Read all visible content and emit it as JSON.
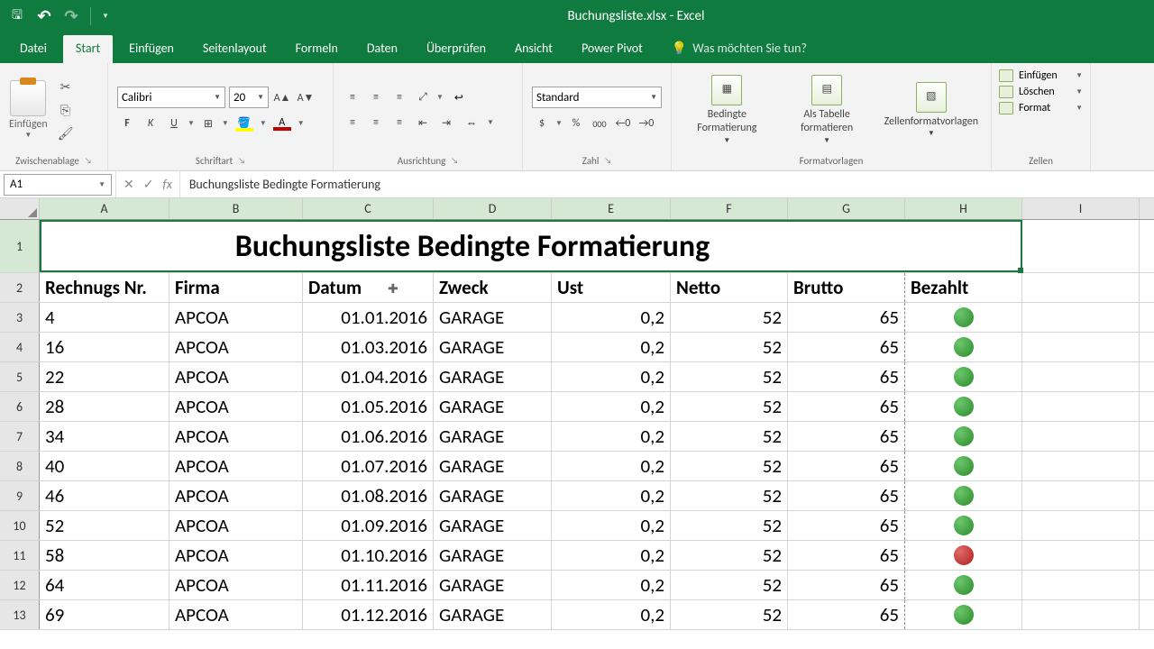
{
  "window": {
    "title": "Buchungsliste.xlsx - Excel"
  },
  "tabs": {
    "file": "Datei",
    "home": "Start",
    "insert": "Einfügen",
    "layout": "Seitenlayout",
    "formulas": "Formeln",
    "data": "Daten",
    "review": "Überprüfen",
    "view": "Ansicht",
    "powerpivot": "Power Pivot",
    "help": "Was möchten Sie tun?"
  },
  "ribbon": {
    "clipboard": {
      "label": "Zwischenablage",
      "paste": "Einfügen"
    },
    "font": {
      "label": "Schriftart",
      "name": "Calibri",
      "size": "20"
    },
    "align": {
      "label": "Ausrichtung"
    },
    "number": {
      "label": "Zahl",
      "format": "Standard"
    },
    "styles": {
      "label": "Formatvorlagen",
      "cond": "Bedingte Formatierung",
      "table": "Als Tabelle formatieren",
      "cellstyles": "Zellenformatvorlagen"
    },
    "cells": {
      "label": "Zellen",
      "insert": "Einfügen",
      "delete": "Löschen",
      "format": "Format"
    }
  },
  "formula": {
    "name_box": "A1",
    "value": "Buchungsliste Bedingte Formatierung"
  },
  "columns": [
    "A",
    "B",
    "C",
    "D",
    "E",
    "F",
    "G",
    "H",
    "I"
  ],
  "sheet": {
    "title": "Buchungsliste Bedingte Formatierung",
    "headers": {
      "nr": "Rechnugs Nr.",
      "firma": "Firma",
      "datum": "Datum",
      "zweck": "Zweck",
      "ust": "Ust",
      "netto": "Netto",
      "brutto": "Brutto",
      "bezahlt": "Bezahlt"
    },
    "rows": [
      {
        "r": "3",
        "nr": "4",
        "firma": "APCOA",
        "datum": "01.01.2016",
        "zweck": "GARAGE",
        "ust": "0,2",
        "netto": "52",
        "brutto": "65",
        "status": "green"
      },
      {
        "r": "4",
        "nr": "16",
        "firma": "APCOA",
        "datum": "01.03.2016",
        "zweck": "GARAGE",
        "ust": "0,2",
        "netto": "52",
        "brutto": "65",
        "status": "green"
      },
      {
        "r": "5",
        "nr": "22",
        "firma": "APCOA",
        "datum": "01.04.2016",
        "zweck": "GARAGE",
        "ust": "0,2",
        "netto": "52",
        "brutto": "65",
        "status": "green"
      },
      {
        "r": "6",
        "nr": "28",
        "firma": "APCOA",
        "datum": "01.05.2016",
        "zweck": "GARAGE",
        "ust": "0,2",
        "netto": "52",
        "brutto": "65",
        "status": "green"
      },
      {
        "r": "7",
        "nr": "34",
        "firma": "APCOA",
        "datum": "01.06.2016",
        "zweck": "GARAGE",
        "ust": "0,2",
        "netto": "52",
        "brutto": "65",
        "status": "green"
      },
      {
        "r": "8",
        "nr": "40",
        "firma": "APCOA",
        "datum": "01.07.2016",
        "zweck": "GARAGE",
        "ust": "0,2",
        "netto": "52",
        "brutto": "65",
        "status": "green"
      },
      {
        "r": "9",
        "nr": "46",
        "firma": "APCOA",
        "datum": "01.08.2016",
        "zweck": "GARAGE",
        "ust": "0,2",
        "netto": "52",
        "brutto": "65",
        "status": "green"
      },
      {
        "r": "10",
        "nr": "52",
        "firma": "APCOA",
        "datum": "01.09.2016",
        "zweck": "GARAGE",
        "ust": "0,2",
        "netto": "52",
        "brutto": "65",
        "status": "green"
      },
      {
        "r": "11",
        "nr": "58",
        "firma": "APCOA",
        "datum": "01.10.2016",
        "zweck": "GARAGE",
        "ust": "0,2",
        "netto": "52",
        "brutto": "65",
        "status": "red"
      },
      {
        "r": "12",
        "nr": "64",
        "firma": "APCOA",
        "datum": "01.11.2016",
        "zweck": "GARAGE",
        "ust": "0,2",
        "netto": "52",
        "brutto": "65",
        "status": "green"
      },
      {
        "r": "13",
        "nr": "69",
        "firma": "APCOA",
        "datum": "01.12.2016",
        "zweck": "GARAGE",
        "ust": "0,2",
        "netto": "52",
        "brutto": "65",
        "status": "green"
      }
    ]
  }
}
